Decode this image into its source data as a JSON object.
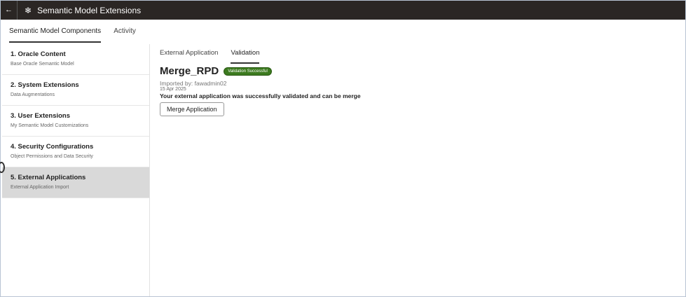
{
  "header": {
    "back_icon": "back-arrow-icon",
    "title": "Semantic Model Extensions"
  },
  "tabs": [
    {
      "label": "Semantic Model Components"
    },
    {
      "label": "Activity"
    }
  ],
  "sidebar": {
    "items": [
      {
        "title": "1. Oracle Content",
        "subtitle": "Base Oracle Semantic Model"
      },
      {
        "title": "2. System Extensions",
        "subtitle": "Data Augmentations"
      },
      {
        "title": "3. User Extensions",
        "subtitle": "My Semantic Model Customizations"
      },
      {
        "title": "4. Security Configurations",
        "subtitle": "Object Permissions and Data Security"
      },
      {
        "title": "5. External Applications",
        "subtitle": "External Application Import"
      }
    ]
  },
  "main": {
    "tabs": [
      {
        "label": "External Application"
      },
      {
        "label": "Validation"
      }
    ],
    "name": "Merge_RPD",
    "badge": "Validation Successful",
    "badge_color": "#3c7a1f",
    "imported_by": "Imported by: fawadmin02",
    "date": "15 Apr 2025",
    "message": "Your external application was successfully validated and can be merge",
    "merge_button": "Merge Application"
  }
}
